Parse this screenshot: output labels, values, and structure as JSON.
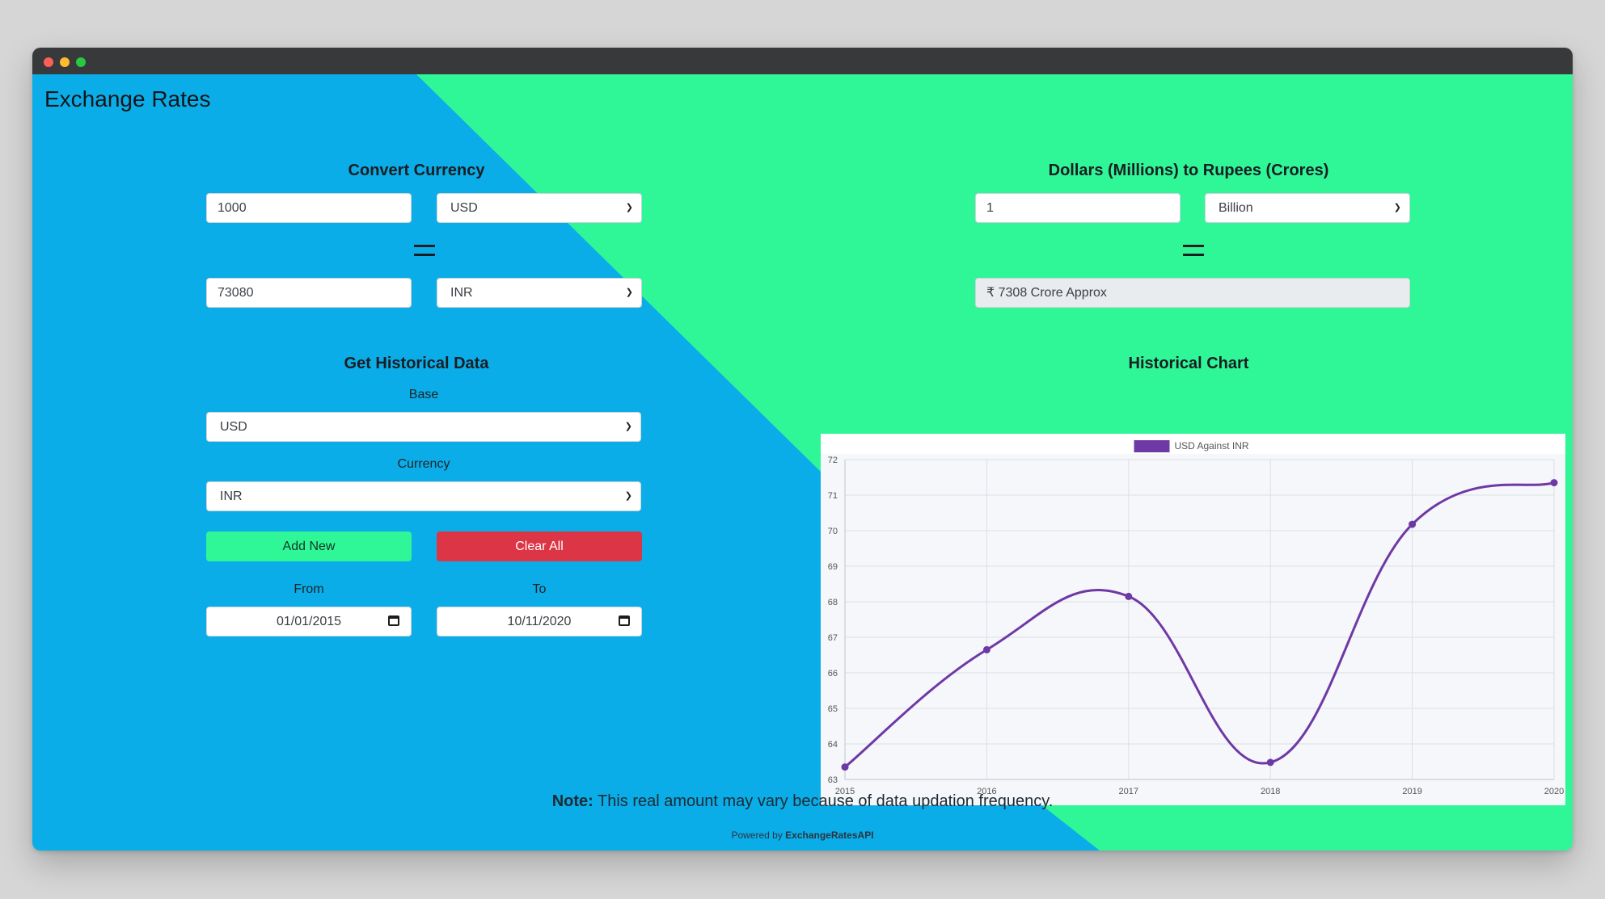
{
  "app": {
    "title": "Exchange Rates"
  },
  "convert": {
    "title": "Convert Currency",
    "amount": "1000",
    "from_currency": "USD",
    "result": "73080",
    "to_currency": "INR"
  },
  "dollars_rupees": {
    "title": "Dollars (Millions) to Rupees (Crores)",
    "amount": "1",
    "unit": "Billion",
    "result": "₹ 7308 Crore Approx"
  },
  "historical": {
    "title": "Get Historical Data",
    "base_label": "Base",
    "base_value": "USD",
    "currency_label": "Currency",
    "currency_value": "INR",
    "add_button": "Add New",
    "clear_button": "Clear All",
    "from_label": "From",
    "from_date": "01/01/2015",
    "to_label": "To",
    "to_date": "10/11/2020"
  },
  "chart_section": {
    "title": "Historical Chart"
  },
  "chart_data": {
    "type": "line",
    "x": [
      "2015",
      "2016",
      "2017",
      "2018",
      "2019",
      "2020"
    ],
    "series": [
      {
        "name": "USD Against INR",
        "values": [
          63.35,
          66.65,
          68.15,
          63.48,
          70.18,
          71.35
        ],
        "color": "#6f39a5"
      }
    ],
    "ylim": [
      63,
      72
    ],
    "yticks": [
      63,
      64,
      65,
      66,
      67,
      68,
      69,
      70,
      71,
      72
    ],
    "grid": true,
    "legend": "top-center",
    "title": "",
    "xlabel": "",
    "ylabel": ""
  },
  "footer": {
    "note_label": "Note:",
    "note_text": " This real amount may vary because of data updation frequency.",
    "powered_prefix": "Powered by ",
    "powered_brand": "ExchangeRatesAPI"
  },
  "colors": {
    "blue": "#0aade8",
    "green": "#2ff797",
    "danger": "#dc3545",
    "line": "#6f39a5"
  }
}
